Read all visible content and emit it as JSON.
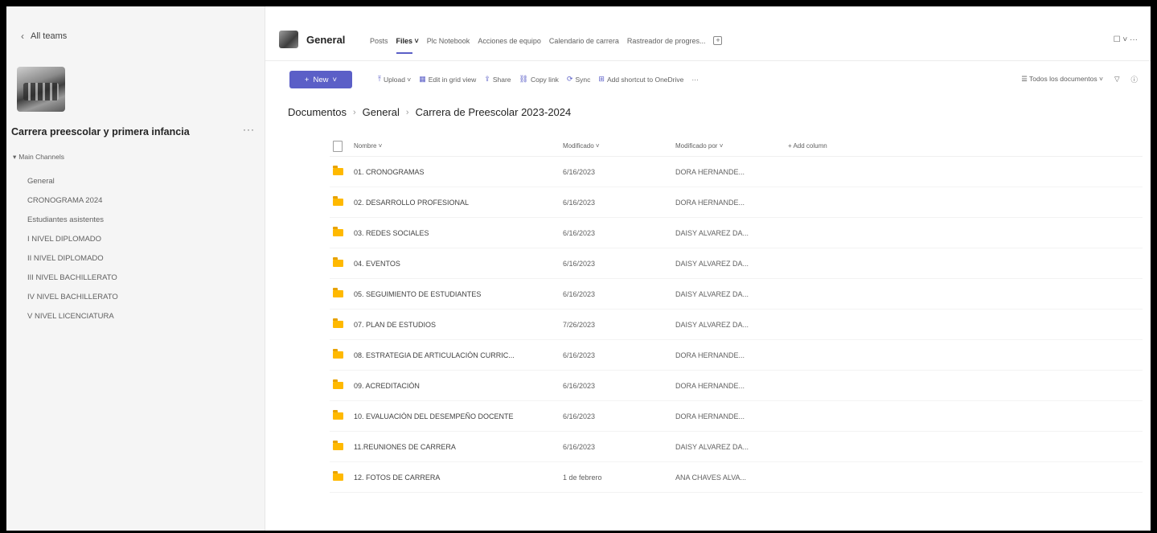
{
  "sidebar": {
    "back_label": "All teams",
    "team_name": "Carrera preescolar y primera infancia",
    "more_label": "···",
    "section_label": "Main Channels",
    "channels": [
      {
        "label": "General"
      },
      {
        "label": "CRONOGRAMA 2024"
      },
      {
        "label": "Estudiantes asistentes"
      },
      {
        "label": "I NIVEL DIPLOMADO"
      },
      {
        "label": "II NIVEL DIPLOMADO"
      },
      {
        "label": "III NIVEL BACHILLERATO"
      },
      {
        "label": "IV NIVEL BACHILLERATO"
      },
      {
        "label": "V NIVEL LICENCIATURA"
      }
    ]
  },
  "header": {
    "title": "General",
    "tabs": [
      {
        "label": "Posts"
      },
      {
        "label": "Files ˅"
      },
      {
        "label": "Plc Notebook"
      },
      {
        "label": "Acciones de equipo"
      },
      {
        "label": "Calendario de carrera"
      },
      {
        "label": "Rastreador de progres..."
      }
    ],
    "right_label": "☐ ˅  ···"
  },
  "toolbar": {
    "new_label": "New",
    "items": [
      {
        "icon": "⤒",
        "label": "Upload ˅"
      },
      {
        "icon": "▦",
        "label": "Edit in grid view"
      },
      {
        "icon": "⇪",
        "label": "Share"
      },
      {
        "icon": "⛓",
        "label": "Copy link"
      },
      {
        "icon": "⟳",
        "label": "Sync"
      },
      {
        "icon": "⊞",
        "label": "Add shortcut to OneDrive"
      },
      {
        "icon": "",
        "label": "···"
      }
    ],
    "view_label": "Todos los documentos ˅",
    "filter_icon": "▽",
    "info_icon": "ⓘ"
  },
  "breadcrumb": {
    "items": [
      {
        "label": "Documentos"
      },
      {
        "label": "General"
      },
      {
        "label": "Carrera de Preescolar 2023-2024"
      }
    ],
    "separator": "›"
  },
  "table": {
    "headers": {
      "name": "Nombre ˅",
      "modified": "Modificado ˅",
      "modified_by": "Modificado por ˅",
      "add_column": "+ Add column"
    },
    "rows": [
      {
        "name": "01. CRONOGRAMAS",
        "modified": "6/16/2023",
        "modified_by": "DORA HERNANDE..."
      },
      {
        "name": "02. DESARROLLO PROFESIONAL",
        "modified": "6/16/2023",
        "modified_by": "DORA HERNANDE..."
      },
      {
        "name": "03. REDES SOCIALES",
        "modified": "6/16/2023",
        "modified_by": "DAISY ALVAREZ DA..."
      },
      {
        "name": "04. EVENTOS",
        "modified": "6/16/2023",
        "modified_by": "DAISY ALVAREZ DA..."
      },
      {
        "name": "05. SEGUIMIENTO DE ESTUDIANTES",
        "modified": "6/16/2023",
        "modified_by": "DAISY ALVAREZ DA..."
      },
      {
        "name": "07. PLAN DE ESTUDIOS",
        "modified": "7/26/2023",
        "modified_by": "DAISY ALVAREZ DA..."
      },
      {
        "name": "08. ESTRATEGIA DE ARTICULACIÓN CURRIC...",
        "modified": "6/16/2023",
        "modified_by": "DORA HERNANDE..."
      },
      {
        "name": "09. ACREDITACIÓN",
        "modified": "6/16/2023",
        "modified_by": "DORA HERNANDE..."
      },
      {
        "name": "10. EVALUACIÓN DEL DESEMPEÑO DOCENTE",
        "modified": "6/16/2023",
        "modified_by": "DORA HERNANDE..."
      },
      {
        "name": "11.REUNIONES DE CARRERA",
        "modified": "6/16/2023",
        "modified_by": "DAISY ALVAREZ DA..."
      },
      {
        "name": "12. FOTOS DE CARRERA",
        "modified": "1 de febrero",
        "modified_by": "ANA CHAVES ALVA..."
      }
    ]
  },
  "colors": {
    "accent": "#5b5fc7",
    "folder": "#ffb900",
    "sidebar_bg": "#f5f5f5"
  }
}
